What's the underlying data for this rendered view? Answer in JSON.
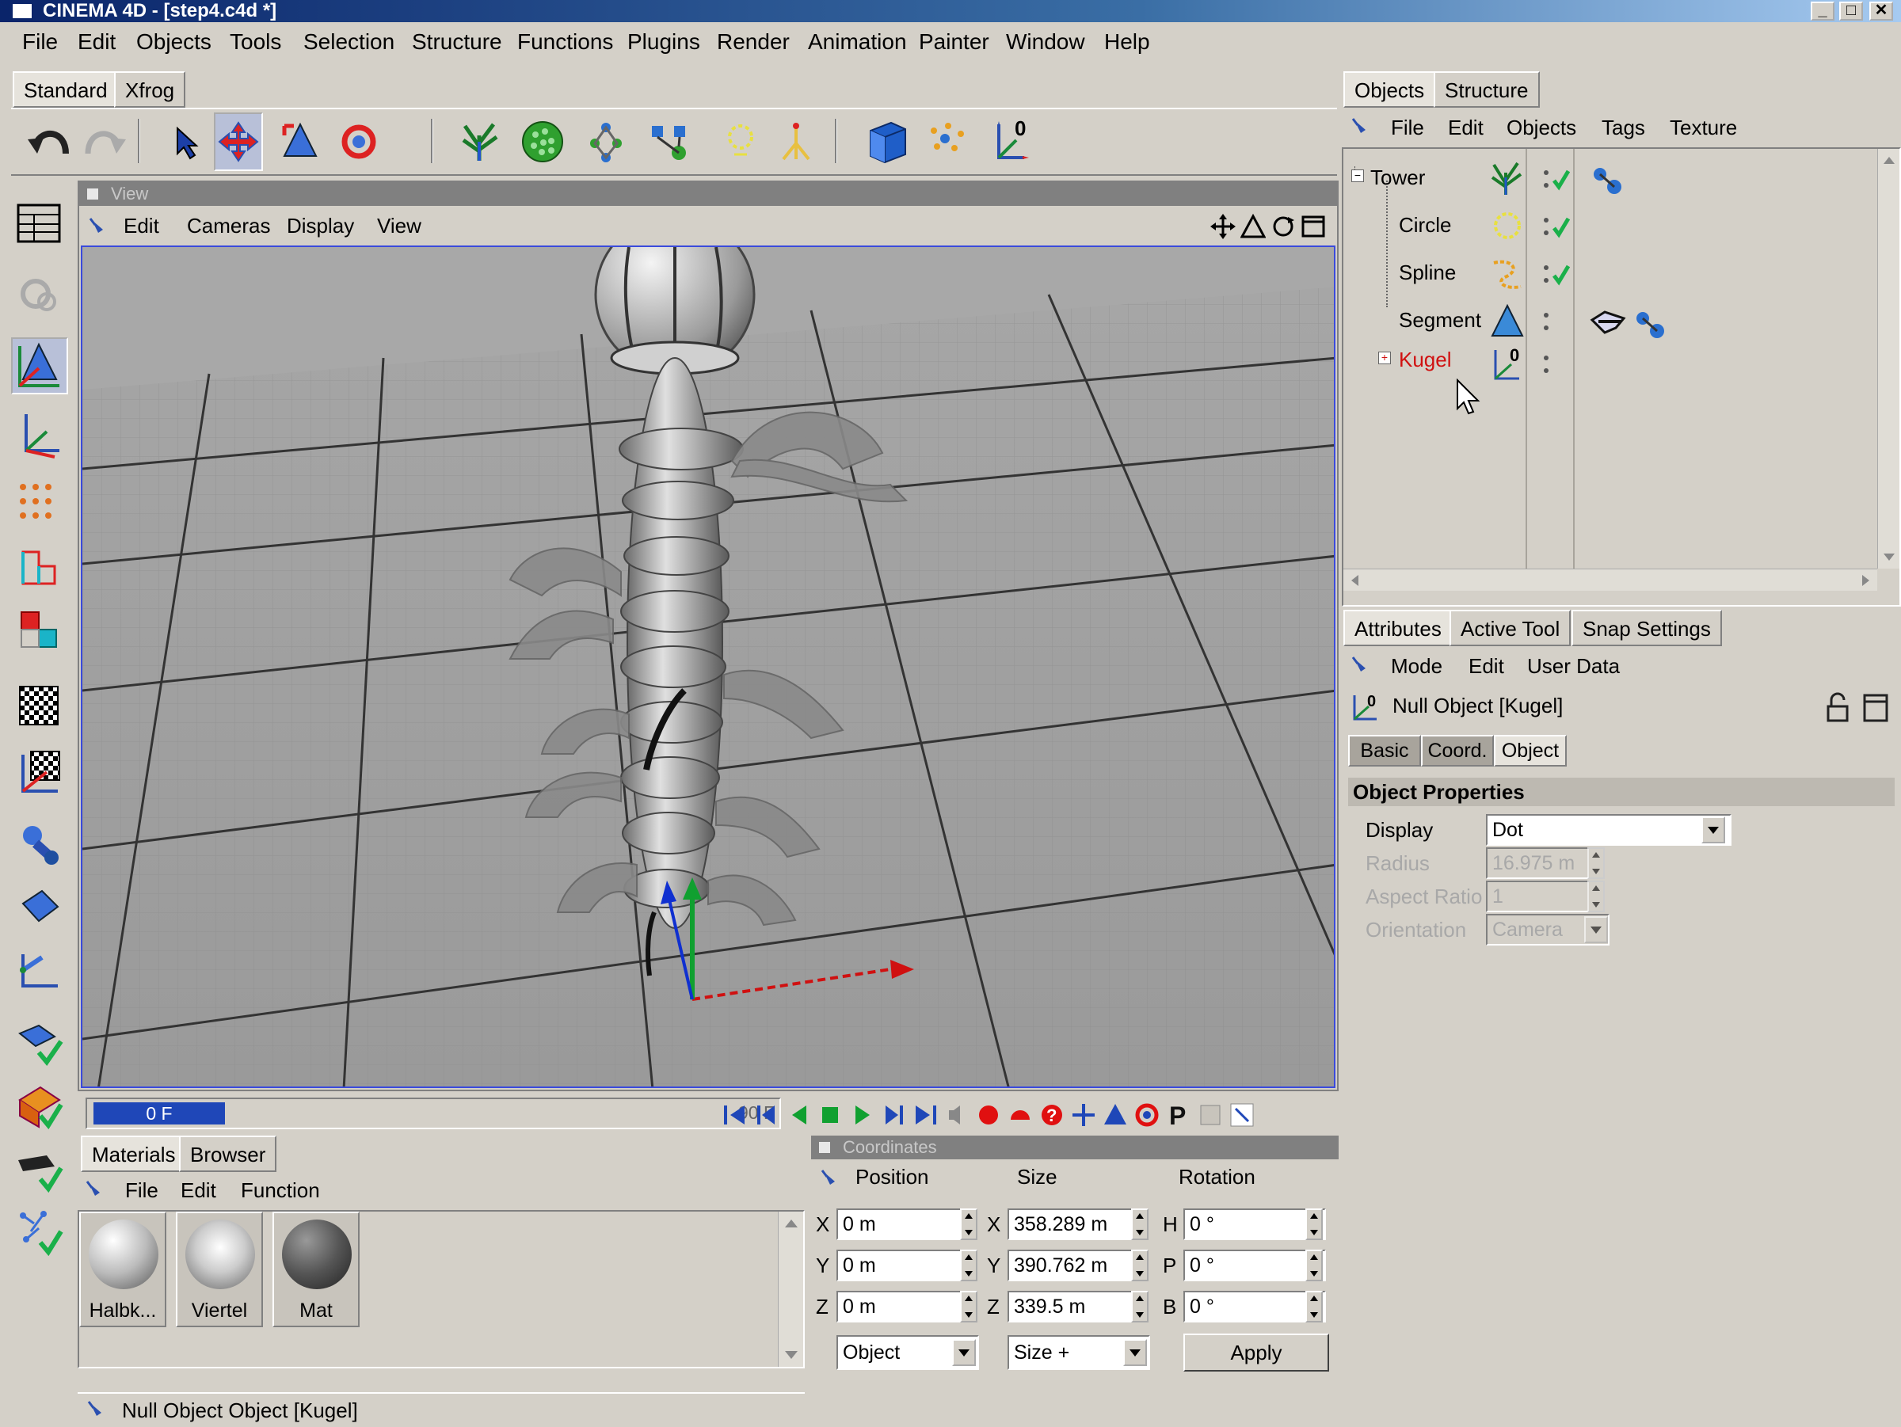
{
  "window": {
    "title": "CINEMA 4D - [step4.c4d *]"
  },
  "menu": [
    "File",
    "Edit",
    "Objects",
    "Tools",
    "Selection",
    "Structure",
    "Functions",
    "Plugins",
    "Render",
    "Animation",
    "Painter",
    "Window",
    "Help"
  ],
  "layout_tabs": [
    "Standard",
    "Xfrog"
  ],
  "toolbar": {
    "axis_label": "0"
  },
  "viewport": {
    "title": "View",
    "menu": [
      "Edit",
      "Cameras",
      "Display",
      "View"
    ]
  },
  "timeline": {
    "current": "0 F",
    "end": "90 F"
  },
  "object_manager": {
    "tabs": [
      "Objects",
      "Structure"
    ],
    "menu": [
      "File",
      "Edit",
      "Objects",
      "Tags",
      "Texture"
    ],
    "tree": [
      {
        "name": "Tower",
        "color": "#000000"
      },
      {
        "name": "Circle",
        "color": "#000000"
      },
      {
        "name": "Spline",
        "color": "#000000"
      },
      {
        "name": "Segment",
        "color": "#000000"
      },
      {
        "name": "Kugel",
        "color": "#d01010"
      }
    ],
    "kugel_icon_label": "0"
  },
  "attributes": {
    "tabs": [
      "Attributes",
      "Active Tool",
      "Snap Settings"
    ],
    "menu": [
      "Mode",
      "Edit",
      "User Data"
    ],
    "object_title": "Null Object [Kugel]",
    "object_icon_label": "0",
    "sub_tabs": [
      "Basic",
      "Coord.",
      "Object"
    ],
    "section_title": "Object Properties",
    "fields": [
      {
        "label": "Display",
        "value": "Dot"
      },
      {
        "label": "Radius",
        "value": "16.975 m"
      },
      {
        "label": "Aspect Ratio",
        "value": "1"
      },
      {
        "label": "Orientation",
        "value": "Camera"
      }
    ]
  },
  "materials": {
    "tabs": [
      "Materials",
      "Browser"
    ],
    "menu": [
      "File",
      "Edit",
      "Function"
    ],
    "items": [
      "Halbk...",
      "Viertel",
      "Mat"
    ]
  },
  "coordinates": {
    "title": "Coordinates",
    "headers": [
      "Position",
      "Size",
      "Rotation"
    ],
    "position": [
      {
        "axis": "X",
        "value": "0 m"
      },
      {
        "axis": "Y",
        "value": "0 m"
      },
      {
        "axis": "Z",
        "value": "0 m"
      }
    ],
    "size": [
      {
        "axis": "X",
        "value": "358.289 m"
      },
      {
        "axis": "Y",
        "value": "390.762 m"
      },
      {
        "axis": "Z",
        "value": "339.5 m"
      }
    ],
    "rotation": [
      {
        "axis": "H",
        "value": "0 °"
      },
      {
        "axis": "P",
        "value": "0 °"
      },
      {
        "axis": "B",
        "value": "0 °"
      }
    ],
    "mode_select": "Object",
    "size_select": "Size +",
    "apply_label": "Apply"
  },
  "statusbar": {
    "text": "Null Object Object [Kugel]"
  }
}
